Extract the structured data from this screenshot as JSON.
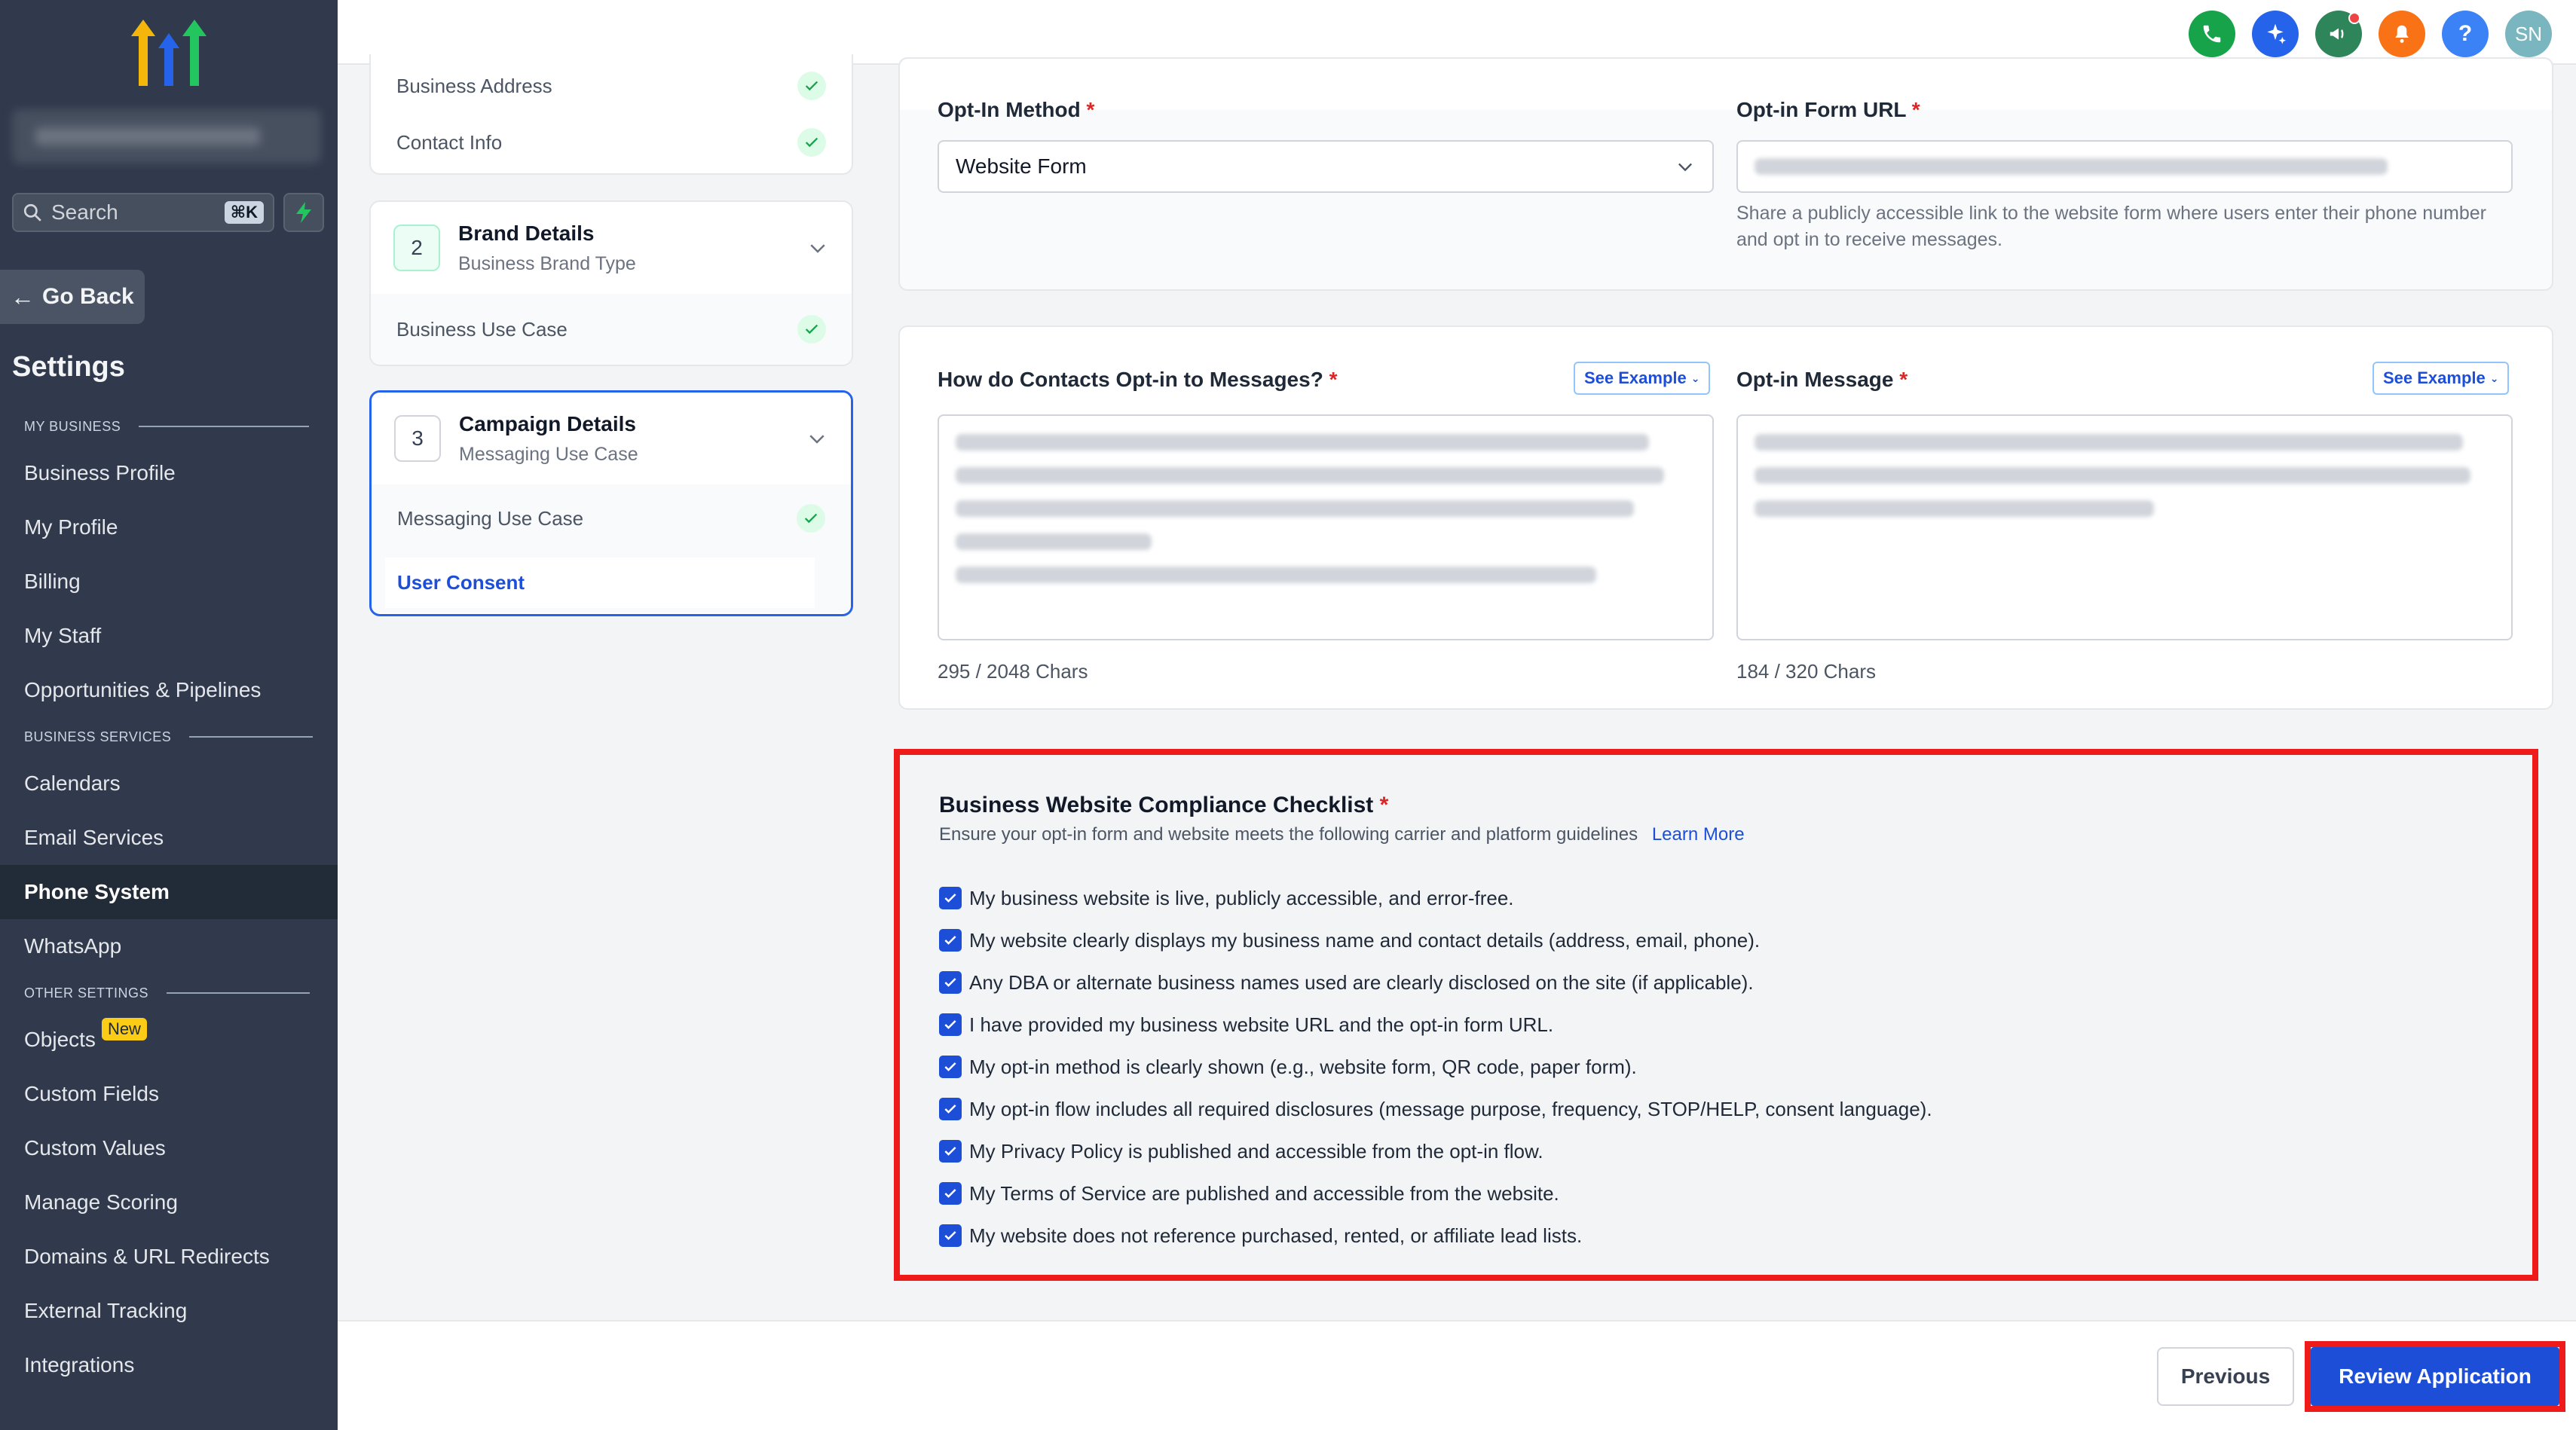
{
  "sidebar": {
    "search_label": "Search",
    "search_shortcut": "⌘K",
    "go_back": "Go Back",
    "settings_title": "Settings",
    "sections": {
      "my_business": "MY BUSINESS",
      "business_services": "BUSINESS SERVICES",
      "other_settings": "OTHER SETTINGS"
    },
    "items": {
      "business_profile": "Business Profile",
      "my_profile": "My Profile",
      "billing": "Billing",
      "my_staff": "My Staff",
      "opportunities": "Opportunities & Pipelines",
      "calendars": "Calendars",
      "email_services": "Email Services",
      "phone_system": "Phone System",
      "whatsapp": "WhatsApp",
      "objects": "Objects",
      "objects_badge": "New",
      "custom_fields": "Custom Fields",
      "custom_values": "Custom Values",
      "manage_scoring": "Manage Scoring",
      "domains": "Domains & URL Redirects",
      "external_tracking": "External Tracking",
      "integrations": "Integrations"
    }
  },
  "topbar": {
    "avatar_initials": "SN",
    "help_label": "?",
    "colors": {
      "phone": "#16a34a",
      "ai": "#2563eb",
      "megaphone": "#2f855a",
      "bell": "#f97316",
      "help": "#3b82f6",
      "avatar": "#7ab6c0"
    }
  },
  "steps": {
    "step1_rows": {
      "business_address": "Business Address",
      "contact_info": "Contact Info"
    },
    "step2": {
      "number": "2",
      "title": "Brand Details",
      "subtitle": "Business Brand Type",
      "row": "Business Use Case"
    },
    "step3": {
      "number": "3",
      "title": "Campaign Details",
      "subtitle": "Messaging Use Case",
      "row1": "Messaging Use Case",
      "row2": "User Consent"
    }
  },
  "form": {
    "opt_in_method": {
      "label": "Opt-In Method",
      "value": "Website Form"
    },
    "opt_in_form_url": {
      "label": "Opt-in Form URL",
      "helper": "Share a publicly accessible link to the website form where users enter their phone number and opt in to receive messages."
    },
    "how_contacts_opt_in": {
      "label": "How do Contacts Opt-in to Messages?",
      "see_example": "See Example",
      "char_count": "295 / 2048 Chars"
    },
    "opt_in_message": {
      "label": "Opt-in Message",
      "see_example": "See Example",
      "char_count": "184 / 320 Chars"
    },
    "required_mark": "*"
  },
  "checklist": {
    "title": "Business Website Compliance Checklist",
    "description": "Ensure your opt-in form and website meets the following carrier and platform guidelines",
    "learn_more": "Learn More",
    "items": [
      "My business website is live, publicly accessible, and error-free.",
      "My website clearly displays my business name and contact details (address, email, phone).",
      "Any DBA or alternate business names used are clearly disclosed on the site (if applicable).",
      "I have provided my business website URL and the opt-in form URL.",
      "My opt-in method is clearly shown (e.g., website form, QR code, paper form).",
      "My opt-in flow includes all required disclosures (message purpose, frequency, STOP/HELP, consent language).",
      "My Privacy Policy is published and accessible from the opt-in flow.",
      "My Terms of Service are published and accessible from the website.",
      "My website does not reference purchased, rented, or affiliate lead lists."
    ],
    "all_checked": true
  },
  "footer": {
    "previous": "Previous",
    "review": "Review Application"
  }
}
